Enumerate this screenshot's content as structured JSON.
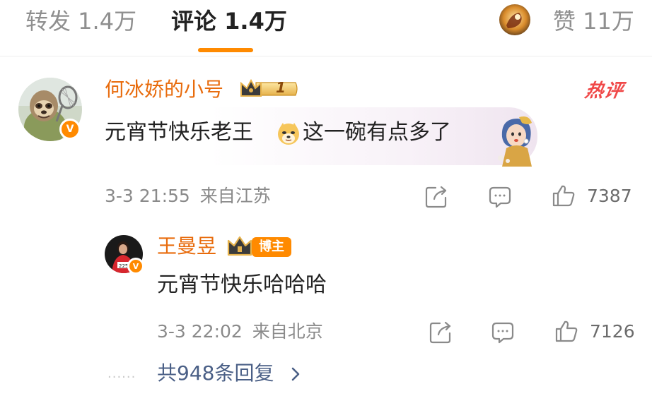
{
  "tabs": {
    "repost": "转发 1.4万",
    "comments": "评论 1.4万",
    "likes": "赞 11万"
  },
  "comments": [
    {
      "username": "何冰娇的小号",
      "vip_level": "1",
      "hot_label": "热评",
      "text_before_emoji": "元宵节快乐老王",
      "emoji": "doge-emoji",
      "text_after_emoji": "这一碗有点多了",
      "timestamp": "3-3 21:55",
      "location": "来自江苏",
      "like_count": "7387"
    },
    {
      "username": "王曼昱",
      "host_tag": "博主",
      "text": "元宵节快乐哈哈哈",
      "timestamp": "3-3 22:02",
      "location": "来自北京",
      "like_count": "7126"
    }
  ],
  "replies_link": "共948条回复",
  "colors": {
    "accent": "#ff8a00",
    "username": "#e86b0c",
    "hot": "#f04848",
    "link": "#4a5f86",
    "meta": "#8a8a8a"
  },
  "icons": [
    "share-icon",
    "comment-icon",
    "thumbs-up-icon",
    "chevron-right-icon",
    "crown-icon",
    "verified-icon"
  ]
}
